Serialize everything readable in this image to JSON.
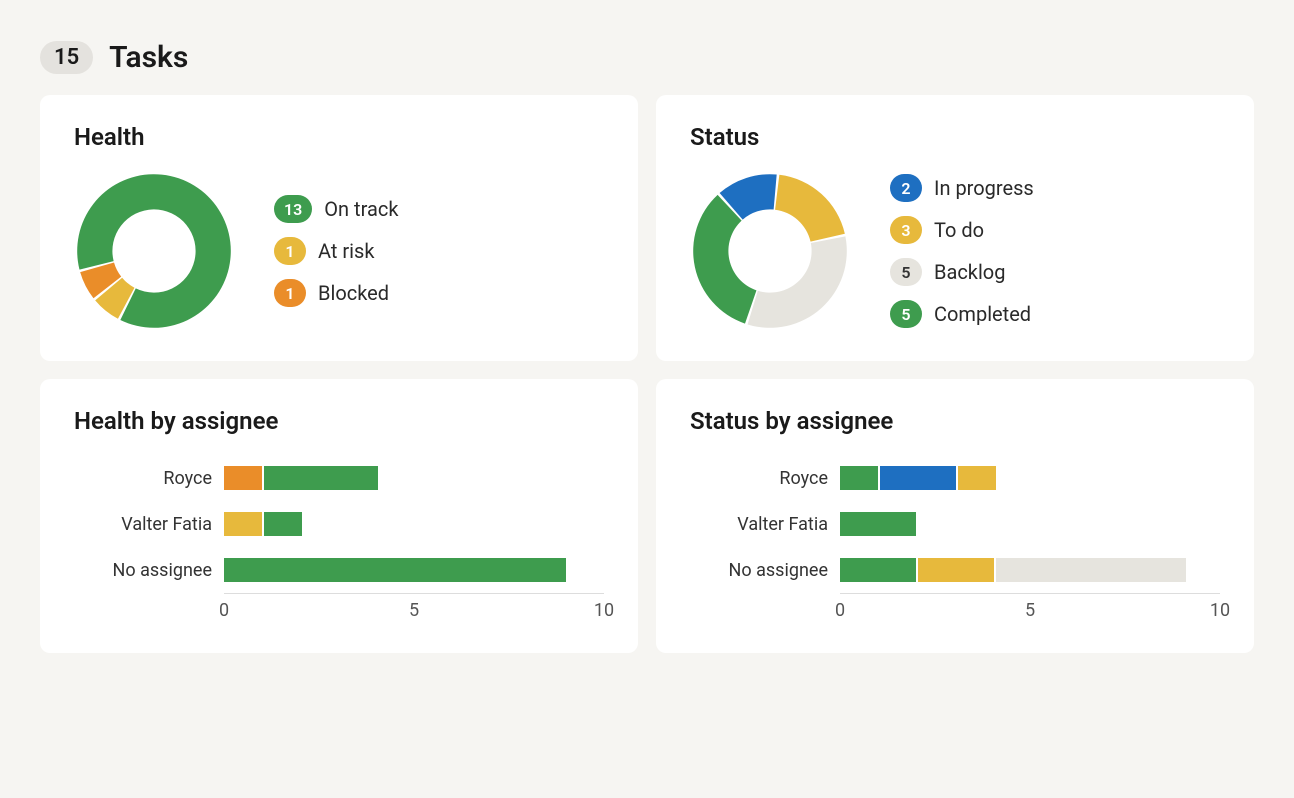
{
  "header": {
    "count": "15",
    "title": "Tasks"
  },
  "colors": {
    "green": "#3e9c4e",
    "yellow": "#e7b93c",
    "orange": "#ea8d29",
    "blue": "#1e6fc1",
    "grey": "#e6e4de"
  },
  "cards": {
    "health": {
      "title": "Health",
      "items": [
        {
          "count": "13",
          "label": "On track",
          "colorKey": "green"
        },
        {
          "count": "1",
          "label": "At risk",
          "colorKey": "yellow"
        },
        {
          "count": "1",
          "label": "Blocked",
          "colorKey": "orange"
        }
      ]
    },
    "status": {
      "title": "Status",
      "items": [
        {
          "count": "2",
          "label": "In progress",
          "colorKey": "blue"
        },
        {
          "count": "3",
          "label": "To do",
          "colorKey": "yellow"
        },
        {
          "count": "5",
          "label": "Backlog",
          "colorKey": "grey",
          "textDark": true
        },
        {
          "count": "5",
          "label": "Completed",
          "colorKey": "green"
        }
      ]
    },
    "health_by_assignee": {
      "title": "Health by assignee",
      "xmax": 10,
      "ticks": [
        0,
        5,
        10
      ],
      "rows": [
        {
          "label": "Royce",
          "segments": [
            {
              "colorKey": "orange",
              "value": 1
            },
            {
              "colorKey": "green",
              "value": 3
            }
          ]
        },
        {
          "label": "Valter Fatia",
          "segments": [
            {
              "colorKey": "yellow",
              "value": 1
            },
            {
              "colorKey": "green",
              "value": 1
            }
          ]
        },
        {
          "label": "No assignee",
          "segments": [
            {
              "colorKey": "green",
              "value": 9
            }
          ]
        }
      ]
    },
    "status_by_assignee": {
      "title": "Status by assignee",
      "xmax": 10,
      "ticks": [
        0,
        5,
        10
      ],
      "rows": [
        {
          "label": "Royce",
          "segments": [
            {
              "colorKey": "green",
              "value": 1
            },
            {
              "colorKey": "blue",
              "value": 2
            },
            {
              "colorKey": "yellow",
              "value": 1
            }
          ]
        },
        {
          "label": "Valter Fatia",
          "segments": [
            {
              "colorKey": "green",
              "value": 2
            }
          ]
        },
        {
          "label": "No assignee",
          "segments": [
            {
              "colorKey": "green",
              "value": 2
            },
            {
              "colorKey": "yellow",
              "value": 2
            },
            {
              "colorKey": "grey",
              "value": 5
            }
          ]
        }
      ]
    }
  },
  "chart_data": [
    {
      "type": "pie",
      "title": "Health",
      "series": [
        {
          "name": "On track",
          "value": 13
        },
        {
          "name": "At risk",
          "value": 1
        },
        {
          "name": "Blocked",
          "value": 1
        }
      ]
    },
    {
      "type": "pie",
      "title": "Status",
      "series": [
        {
          "name": "In progress",
          "value": 2
        },
        {
          "name": "To do",
          "value": 3
        },
        {
          "name": "Backlog",
          "value": 5
        },
        {
          "name": "Completed",
          "value": 5
        }
      ]
    },
    {
      "type": "bar",
      "title": "Health by assignee",
      "xlabel": "",
      "ylabel": "",
      "xlim": [
        0,
        10
      ],
      "categories": [
        "Royce",
        "Valter Fatia",
        "No assignee"
      ],
      "series": [
        {
          "name": "On track",
          "values": [
            3,
            1,
            9
          ]
        },
        {
          "name": "At risk",
          "values": [
            0,
            1,
            0
          ]
        },
        {
          "name": "Blocked",
          "values": [
            1,
            0,
            0
          ]
        }
      ]
    },
    {
      "type": "bar",
      "title": "Status by assignee",
      "xlabel": "",
      "ylabel": "",
      "xlim": [
        0,
        10
      ],
      "categories": [
        "Royce",
        "Valter Fatia",
        "No assignee"
      ],
      "series": [
        {
          "name": "In progress",
          "values": [
            2,
            0,
            0
          ]
        },
        {
          "name": "To do",
          "values": [
            1,
            0,
            2
          ]
        },
        {
          "name": "Backlog",
          "values": [
            0,
            0,
            5
          ]
        },
        {
          "name": "Completed",
          "values": [
            1,
            2,
            2
          ]
        }
      ]
    }
  ]
}
